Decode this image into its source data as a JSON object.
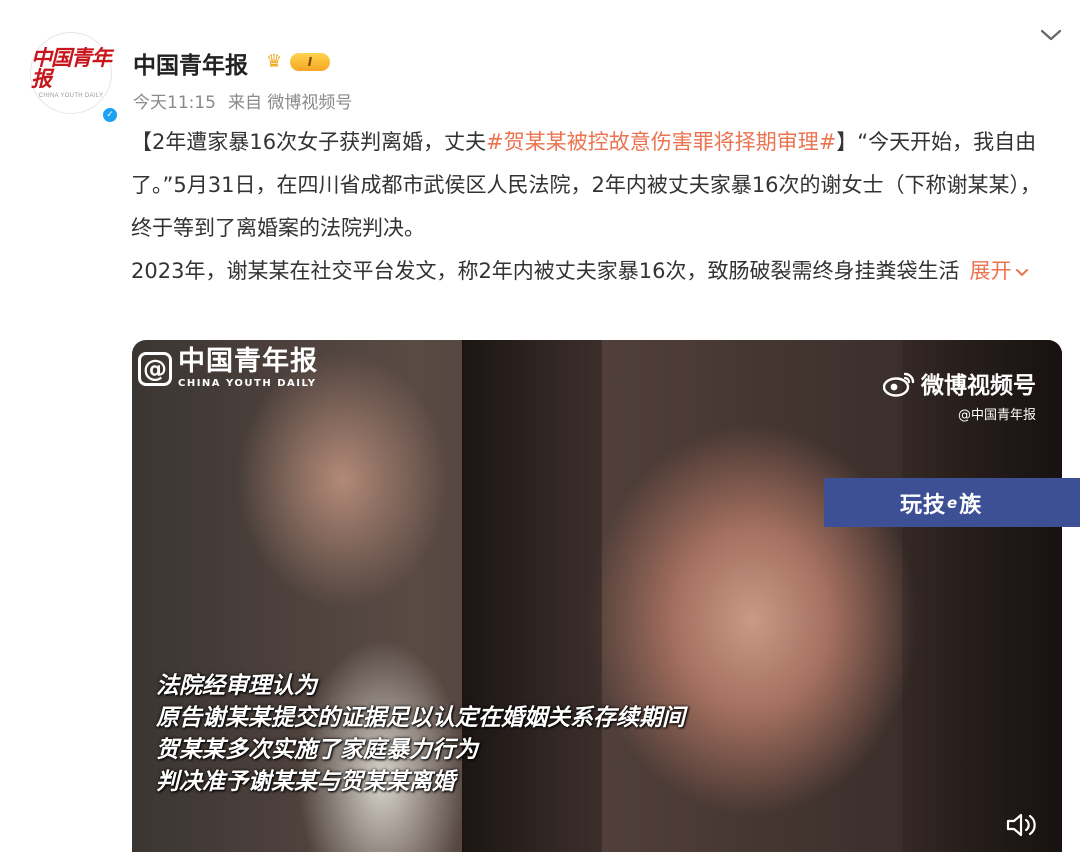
{
  "post": {
    "author": {
      "name": "中国青年报",
      "avatar_logo_cn": "中国青年报",
      "avatar_logo_en": "CHINA YOUTH DAILY",
      "badge_level": "I"
    },
    "time": "今天11:15",
    "source": "来自 微博视频号",
    "text": {
      "p1_start": "【2年遭家暴16次女子获判离婚，丈夫",
      "p1_hashtag": "#贺某某被控故意伤害罪将择期审理#",
      "p1_end": "】“今天开始，我自由了。”5月31日，在四川省成都市武侯区人民法院，2年内被丈夫家暴16次的谢女士（下称谢某某），终于等到了离婚案的法院判决。",
      "p2": "2023年，谢某某在社交平台发文，称2年内被丈夫家暴16次，致肠破裂需终身挂粪袋生活",
      "more_label": "展开"
    },
    "video": {
      "watermark_left_cn": "中国青年报",
      "watermark_left_en": "CHINA YOUTH DAILY",
      "watermark_right_title": "微博视频号",
      "watermark_right_handle": "@中国青年报",
      "subtitles": [
        "法院经审理认为",
        "原告谢某某提交的证据足以认定在婚姻关系存续期间",
        "贺某某多次实施了家庭暴力行为",
        "判决准予谢某某与贺某某离婚"
      ]
    }
  },
  "banner": {
    "text_before": "玩技",
    "text_e": "e",
    "text_after": "族"
  },
  "colors": {
    "hashtag": "#eb7350",
    "banner_bg": "#3d4f95",
    "verified": "#1da1f2"
  },
  "icons": [
    "verified-icon",
    "crown-icon",
    "chevron-down-icon",
    "weibo-icon",
    "sound-icon"
  ]
}
